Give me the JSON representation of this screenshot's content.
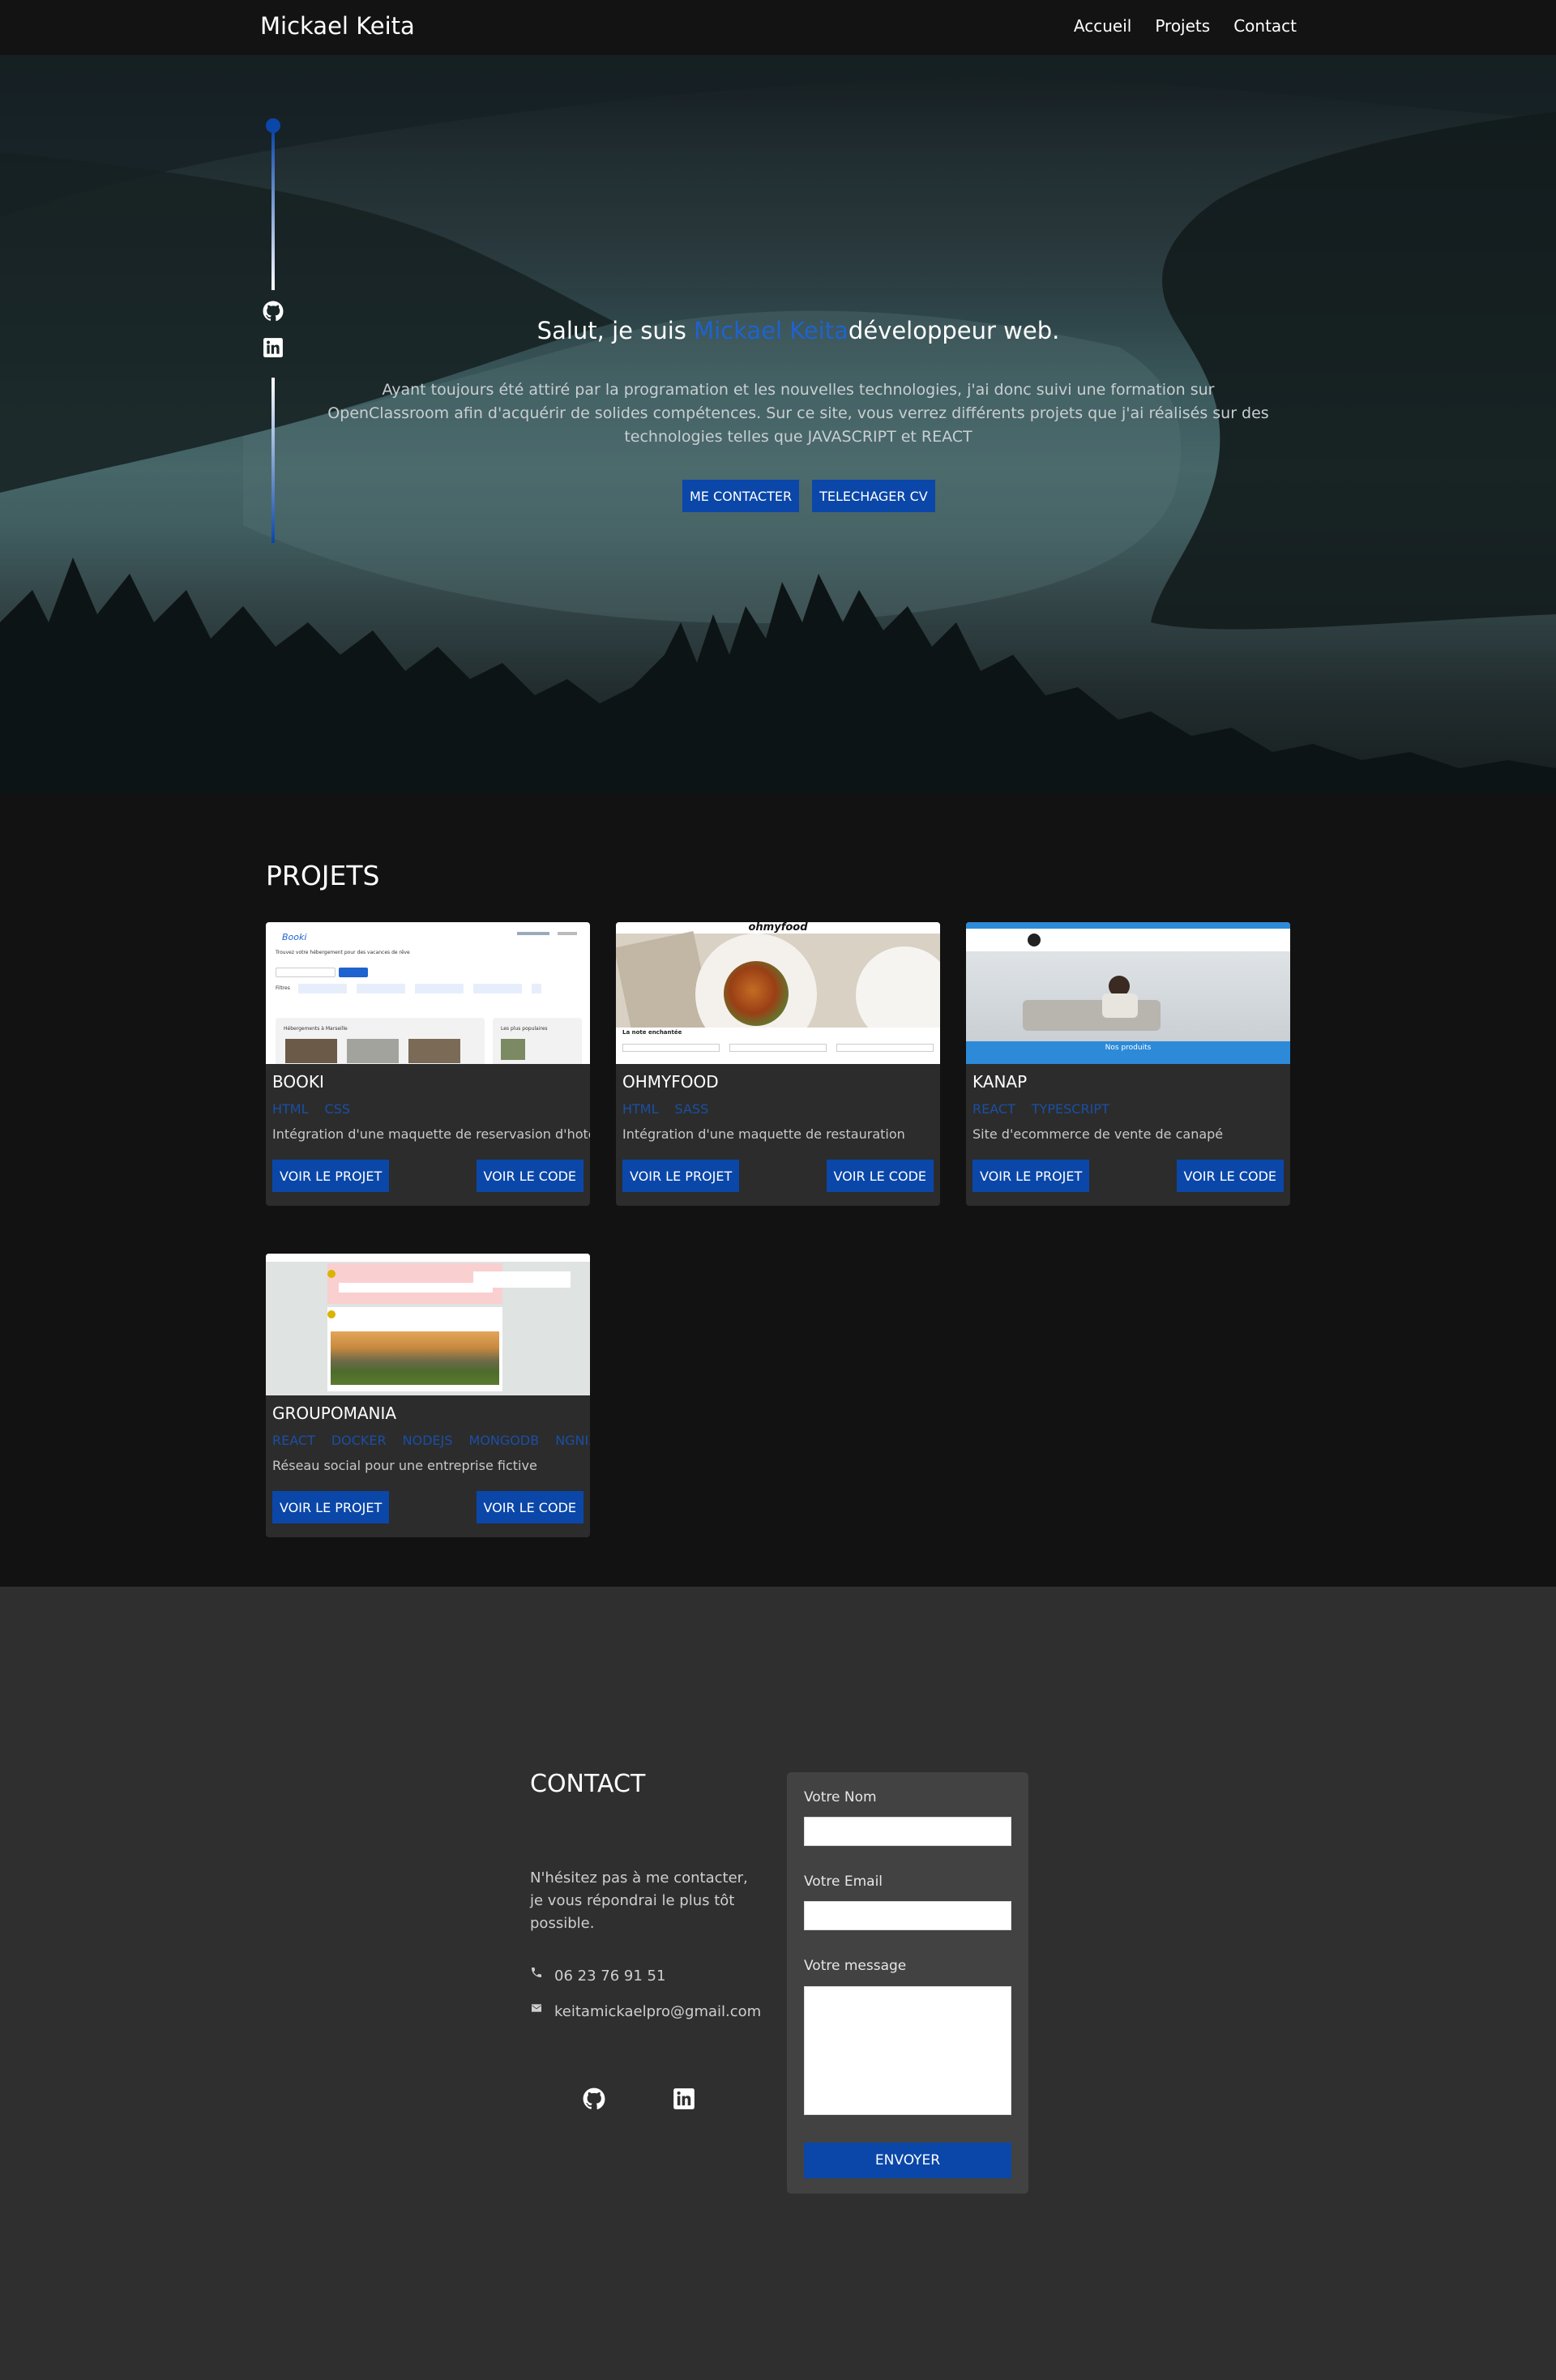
{
  "nav": {
    "brand": "Mickael Keita",
    "links": [
      "Accueil",
      "Projets",
      "Contact"
    ]
  },
  "hero": {
    "title_before": "Salut, je suis ",
    "title_name": "Mickael Keita",
    "title_after": "développeur web.",
    "description": "Ayant toujours été attiré par la programation et les nouvelles technologies, j'ai donc suivi une formation sur OpenClassroom afin d'acquérir de solides compétences. Sur ce site, vous verrez différents projets que j'ai réalisés sur des technologies telles que JAVASCRIPT et REACT",
    "contact_button": "ME CONTACTER",
    "cv_button": "TELECHAGER CV",
    "social_icons": [
      "github-icon",
      "linkedin-icon"
    ]
  },
  "projects": {
    "title": "PROJETS",
    "items": [
      {
        "name": "BOOKI",
        "tags": [
          "HTML",
          "CSS"
        ],
        "description": "Intégration d'une maquette de reservasion d'hotel",
        "view_label": "VOIR LE PROJET",
        "code_label": "VOIR LE CODE"
      },
      {
        "name": "OHMYFOOD",
        "tags": [
          "HTML",
          "SASS"
        ],
        "description": "Intégration d'une maquette de restauration",
        "view_label": "VOIR LE PROJET",
        "code_label": "VOIR LE CODE"
      },
      {
        "name": "KANAP",
        "tags": [
          "REACT",
          "TYPESCRIPT"
        ],
        "description": "Site d'ecommerce de vente de canapé",
        "view_label": "VOIR LE PROJET",
        "code_label": "VOIR LE CODE"
      },
      {
        "name": "GROUPOMANIA",
        "tags": [
          "REACT",
          "DOCKER",
          "NODEJS",
          "MONGODB",
          "NGNIX"
        ],
        "description": "Réseau social pour une entreprise fictive",
        "view_label": "VOIR LE PROJET",
        "code_label": "VOIR LE CODE"
      }
    ],
    "thumb_text": {
      "booki_logo": "Booki",
      "booki_heading": "Trouvez votre hébergement pour des vacances de rêve",
      "booki_filters": "Filtres",
      "booki_sec1": "Hébergements à Marseille",
      "booki_sec2": "Les plus populaires",
      "ohmyfood_logo": "ohmyfood",
      "ohmyfood_caption": "La note enchantée",
      "kanap_caption": "Nos produits"
    }
  },
  "contact": {
    "title": "CONTACT",
    "text": "N'hésitez pas à me contacter, je vous répondrai le plus tôt possible.",
    "phone": "06 23 76 91 51",
    "email": "keitamickaelpro@gmail.com",
    "form": {
      "name_label": "Votre Nom",
      "email_label": "Votre Email",
      "message_label": "Votre message",
      "send_label": "ENVOYER"
    }
  },
  "colors": {
    "accent": "#0a47a9",
    "highlight": "#1e63cf",
    "nav_bg": "#131313",
    "card_bg": "#2c2c2c",
    "contact_bg": "#2f2f2f"
  }
}
